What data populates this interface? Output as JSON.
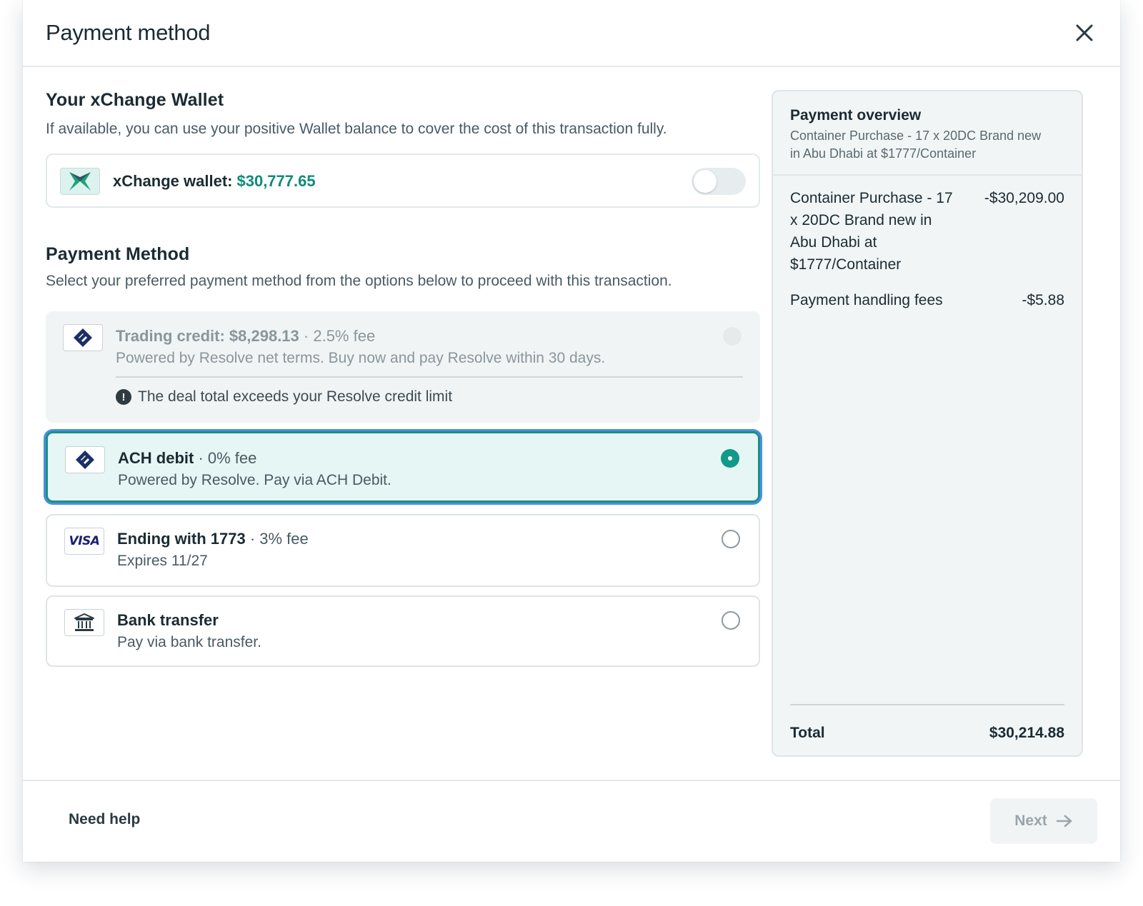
{
  "modal": {
    "title": "Payment method"
  },
  "wallet_section": {
    "title": "Your xChange Wallet",
    "description": "If available, you can use your positive Wallet balance to cover the cost of this transaction fully.",
    "label": "xChange wallet:",
    "amount": "$30,777.65",
    "toggle_on": false
  },
  "payment_section": {
    "title": "Payment Method",
    "description": "Select your preferred payment method from the options below to proceed with this transaction."
  },
  "options": [
    {
      "name": "Trading credit: $8,298.13",
      "fee": "· 2.5% fee",
      "sub": "Powered by Resolve net terms. Buy now and pay Resolve within 30 days.",
      "warning": "The deal total exceeds your Resolve credit limit",
      "state": "disabled",
      "icon": "resolve-icon"
    },
    {
      "name": "ACH debit",
      "fee": "· 0% fee",
      "sub": "Powered by Resolve. Pay via ACH Debit.",
      "state": "selected",
      "icon": "resolve-icon"
    },
    {
      "name": "Ending with 1773",
      "fee": "· 3% fee",
      "sub": "Expires 11/27",
      "state": "unselected",
      "icon": "visa-icon",
      "icon_text": "VISA"
    },
    {
      "name": "Bank transfer",
      "fee": "",
      "sub": "Pay via bank transfer.",
      "state": "unselected",
      "icon": "bank-icon"
    }
  ],
  "overview": {
    "title": "Payment overview",
    "subtitle": "Container Purchase - 17 x 20DC Brand new in Abu Dhabi at $1777/Container",
    "lines": [
      {
        "label": "Container Purchase - 17 x 20DC Brand new in Abu Dhabi at $1777/Container",
        "amount": "-$30,209.00"
      },
      {
        "label": "Payment handling fees",
        "amount": "-$5.88"
      }
    ],
    "total_label": "Total",
    "total_amount": "$30,214.88"
  },
  "footer": {
    "help_label": "Need help",
    "next_label": "Next"
  },
  "colors": {
    "accent": "#11998a",
    "focus_ring": "#4a90e2",
    "selected_bg": "#e5f6f4",
    "wallet_amount": "#0f8a7c"
  }
}
